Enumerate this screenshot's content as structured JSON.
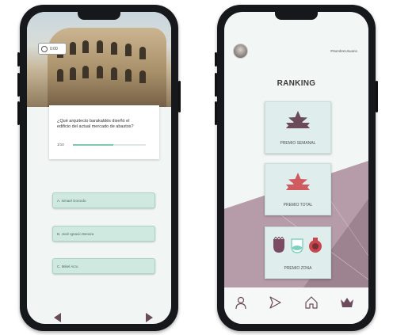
{
  "quiz": {
    "timer": "0:00",
    "question": "¿Qué arquitecto barakaldés diseñó el edificio del actual mercado de abastos?",
    "progress_text": "1/10",
    "progress": 0.55,
    "answers": [
      "A. Ismael Gorordo",
      "B. José Ignacio Beraza",
      "C. Mikel Arzu"
    ],
    "prev_icon": "chevron-left-icon",
    "next_icon": "chevron-right-icon",
    "accent": "#cfe9e0",
    "arrow_color": "#6b4a5a"
  },
  "ranking": {
    "username": "#NombreUsuario",
    "title": "RANKING",
    "prizes": [
      {
        "label": "PREMIO SEMANAL",
        "icon": "star-ribbon-icon",
        "color": "#6b4a5a"
      },
      {
        "label": "PREMIO TOTAL",
        "icon": "star-ribbon-icon",
        "color": "#cf5b60"
      },
      {
        "label": "PREMIO ZONA",
        "icon": "zone-badges-icon",
        "colors": [
          "#7a4b62",
          "#7fd0c0",
          "#c8474e"
        ]
      }
    ],
    "tabs": [
      {
        "name": "profile",
        "icon": "user-icon"
      },
      {
        "name": "play",
        "icon": "play-icon"
      },
      {
        "name": "home",
        "icon": "home-icon"
      },
      {
        "name": "ranking",
        "icon": "crown-icon",
        "active": true
      }
    ],
    "background_color": "#b59ca8"
  }
}
